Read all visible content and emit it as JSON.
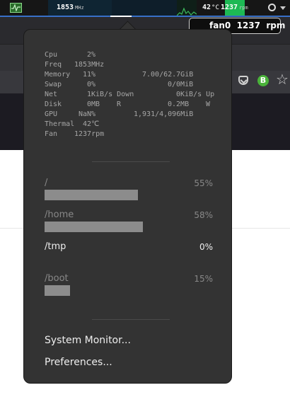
{
  "topbar": {
    "cpu_freq_value": "1853",
    "cpu_freq_unit": "MHz",
    "temp_value": "42",
    "temp_unit": "°C",
    "fan_value": "1237",
    "fan_unit": "rpm"
  },
  "tooltip": {
    "label": "fan0  1237  rpm"
  },
  "stats": [
    {
      "label": "Cpu",
      "v1": "2%",
      "v2": "",
      "v3": ""
    },
    {
      "label": "Freq",
      "v1": "1853MHz",
      "v2": "",
      "v3": ""
    },
    {
      "label": "Memory",
      "v1": "11%",
      "v2": "7.00/62.7GiB",
      "v3": ""
    },
    {
      "label": "Swap",
      "v1": "0%",
      "v2": "0/0MiB",
      "v3": ""
    },
    {
      "label": "Net",
      "v1": "1KiB/s Down",
      "v2": "0KiB/s Up",
      "v3": ""
    },
    {
      "label": "Disk",
      "v1": "0MB",
      "v2": "R",
      "v3": "0.2MB",
      "v4": "W"
    },
    {
      "label": "GPU",
      "v1": "NaN%",
      "v2": "1,931/4,096MiB",
      "v3": ""
    },
    {
      "label": "Thermal",
      "v1": "42℃",
      "v2": "",
      "v3": ""
    },
    {
      "label": "Fan",
      "v1": "1237rpm",
      "v2": "",
      "v3": ""
    }
  ],
  "disks": [
    {
      "mount": "/",
      "percent": "55%",
      "usage_fraction": 0.55
    },
    {
      "mount": "/home",
      "percent": "58%",
      "usage_fraction": 0.58
    },
    {
      "mount": "/tmp",
      "percent": "0%",
      "usage_fraction": 0.0
    },
    {
      "mount": "/boot",
      "percent": "15%",
      "usage_fraction": 0.15
    }
  ],
  "menu": {
    "system_monitor": "System Monitor...",
    "preferences": "Preferences..."
  },
  "colors": {
    "popup_bg": "#333333",
    "bar_fill": "#8c8c8c",
    "panel_bg": "#161616",
    "accent_green": "#1db954",
    "panel_underline": "#3870c8"
  }
}
